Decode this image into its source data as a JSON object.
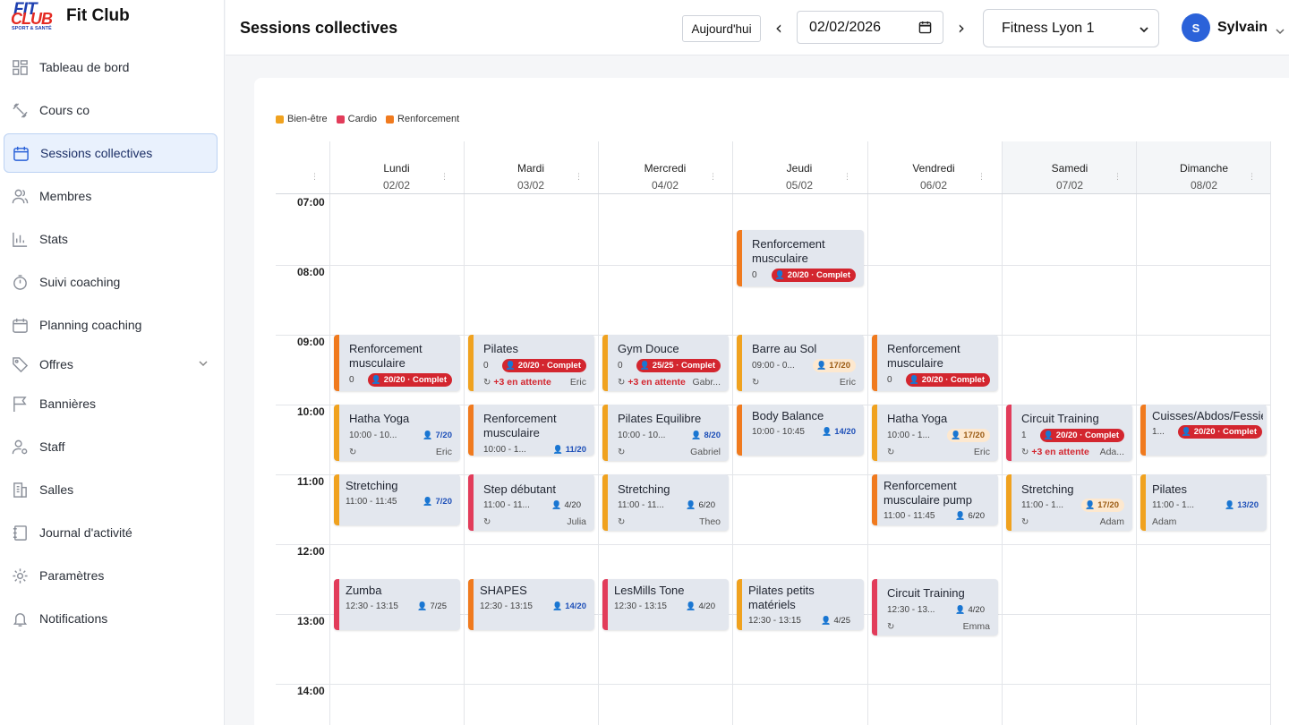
{
  "brand": {
    "logo_line1": "FIT",
    "logo_line2": "CLUB",
    "logo_tag": "SPORT & SANTÉ",
    "name": "Fit Club"
  },
  "sidebar": {
    "items": [
      {
        "label": "Tableau de bord",
        "icon": "dashboard-icon"
      },
      {
        "label": "Cours co",
        "icon": "dumbbell-icon"
      },
      {
        "label": "Sessions collectives",
        "icon": "calendar-icon",
        "active": true
      },
      {
        "label": "Membres",
        "icon": "users-icon"
      },
      {
        "label": "Stats",
        "icon": "chart-icon"
      },
      {
        "label": "Suivi coaching",
        "icon": "stopwatch-icon"
      },
      {
        "label": "Planning coaching",
        "icon": "calendar-icon"
      },
      {
        "label": "Offres",
        "icon": "tag-icon"
      },
      {
        "label": "Bannières",
        "icon": "flag-icon"
      },
      {
        "label": "Staff",
        "icon": "user-gear-icon"
      },
      {
        "label": "Salles",
        "icon": "building-icon"
      },
      {
        "label": "Journal d'activité",
        "icon": "notebook-icon"
      },
      {
        "label": "Paramètres",
        "icon": "gear-icon"
      },
      {
        "label": "Notifications",
        "icon": "bell-icon"
      }
    ]
  },
  "header": {
    "title": "Sessions collectives",
    "today_label": "Aujourd'hui",
    "date_value": "02/02/2026",
    "location": "Fitness Lyon 1",
    "user_initial": "S",
    "user_name": "Sylvain"
  },
  "legend": [
    {
      "label": "Bien-être",
      "color": "#f0a21f"
    },
    {
      "label": "Cardio",
      "color": "#e23c5a"
    },
    {
      "label": "Renforcement",
      "color": "#f07a1e"
    }
  ],
  "days": [
    {
      "name": "Lundi",
      "date": "02/02"
    },
    {
      "name": "Mardi",
      "date": "03/02"
    },
    {
      "name": "Mercredi",
      "date": "04/02"
    },
    {
      "name": "Jeudi",
      "date": "05/02"
    },
    {
      "name": "Vendredi",
      "date": "06/02"
    },
    {
      "name": "Samedi",
      "date": "07/02"
    },
    {
      "name": "Dimanche",
      "date": "08/02"
    }
  ],
  "hours": [
    "07:00",
    "08:00",
    "09:00",
    "10:00",
    "11:00",
    "12:00",
    "13:00",
    "14:00"
  ],
  "events": [
    {
      "title": "Renforcement musculaire",
      "cat": "renfo",
      "time": "0",
      "badge": "20/20 · Complet",
      "state": "full"
    },
    {
      "title": "Renforcement musculaire",
      "cat": "renfo",
      "time": "0",
      "badge": "20/20 · Complet",
      "state": "full"
    },
    {
      "title": "Pilates",
      "cat": "bien",
      "time": "0",
      "badge": "20/20 · Complet",
      "state": "full",
      "waitlist": "+3 en attente",
      "coach": "Eric"
    },
    {
      "title": "Gym Douce",
      "cat": "bien",
      "time": "0",
      "badge": "25/25 · Complet",
      "state": "full",
      "waitlist": "+3 en attente",
      "coach": "Gabr..."
    },
    {
      "title": "Barre au Sol",
      "cat": "bien",
      "time": "09:00 - 0...",
      "badge": "17/20",
      "state": "warn",
      "coach": "Eric"
    },
    {
      "title": "Renforcement musculaire",
      "cat": "renfo",
      "time": "0",
      "badge": "20/20 · Complet",
      "state": "full"
    },
    {
      "title": "Hatha Yoga",
      "cat": "bien",
      "time": "10:00 - 10...",
      "badge": "7/20",
      "state": "ok",
      "coach": "Eric"
    },
    {
      "title": "Renforcement musculaire",
      "cat": "renfo",
      "time": "10:00 - 1...",
      "badge": "11/20",
      "state": "ok"
    },
    {
      "title": "Pilates Equilibre",
      "cat": "bien",
      "time": "10:00 - 10...",
      "badge": "8/20",
      "state": "ok",
      "coach": "Gabriel"
    },
    {
      "title": "Body Balance",
      "cat": "renfo",
      "time": "10:00 - 10:45",
      "badge": "14/20",
      "state": "ok"
    },
    {
      "title": "Hatha Yoga",
      "cat": "bien",
      "time": "10:00 - 1...",
      "badge": "17/20",
      "state": "warn",
      "coach": "Eric"
    },
    {
      "title": "Circuit Training",
      "cat": "cardio",
      "time": "1",
      "badge": "20/20 · Complet",
      "state": "full",
      "waitlist": "+3 en attente",
      "coach": "Ada..."
    },
    {
      "title": "Cuisses/Abdos/Fessiers",
      "cat": "renfo",
      "time": "1...",
      "badge": "20/20 · Complet",
      "state": "full"
    },
    {
      "title": "Stretching",
      "cat": "bien",
      "time": "11:00 - 11:45",
      "badge": "7/20",
      "state": "ok"
    },
    {
      "title": "Step débutant",
      "cat": "cardio",
      "time": "11:00 - 11...",
      "badge": "4/20",
      "state": "plain",
      "coach": "Julia"
    },
    {
      "title": "Stretching",
      "cat": "bien",
      "time": "11:00 - 11...",
      "badge": "6/20",
      "state": "plain",
      "coach": "Theo"
    },
    {
      "title": "Renforcement musculaire pump",
      "cat": "renfo",
      "time": "11:00 - 11:45",
      "badge": "6/20",
      "state": "plain"
    },
    {
      "title": "Stretching",
      "cat": "bien",
      "time": "11:00 - 1...",
      "badge": "17/20",
      "state": "warn",
      "coach": "Adam"
    },
    {
      "title": "Pilates",
      "cat": "bien",
      "time": "11:00 - 1...",
      "badge": "13/20",
      "state": "ok",
      "coach2": "Adam"
    },
    {
      "title": "Zumba",
      "cat": "cardio",
      "time": "12:30 - 13:15",
      "badge": "7/25",
      "state": "plain"
    },
    {
      "title": "SHAPES",
      "cat": "renfo",
      "time": "12:30 - 13:15",
      "badge": "14/20",
      "state": "ok"
    },
    {
      "title": "LesMills Tone",
      "cat": "cardio",
      "time": "12:30 - 13:15",
      "badge": "4/20",
      "state": "plain"
    },
    {
      "title": "Pilates petits matériels",
      "cat": "bien",
      "time": "12:30 - 13:15",
      "badge": "4/25",
      "state": "plain"
    },
    {
      "title": "Circuit Training",
      "cat": "cardio",
      "time": "12:30 - 13...",
      "badge": "4/20",
      "state": "plain",
      "coach": "Emma"
    }
  ],
  "colors": {
    "bien": "#f0a21f",
    "cardio": "#e23c5a",
    "renfo": "#f07a1e",
    "accent": "#2b62d9",
    "full": "#d3262f"
  },
  "icons": {
    "refresh": "↻",
    "person": "👤",
    "prev": "‹",
    "next": "›",
    "kebab": "⋮"
  }
}
